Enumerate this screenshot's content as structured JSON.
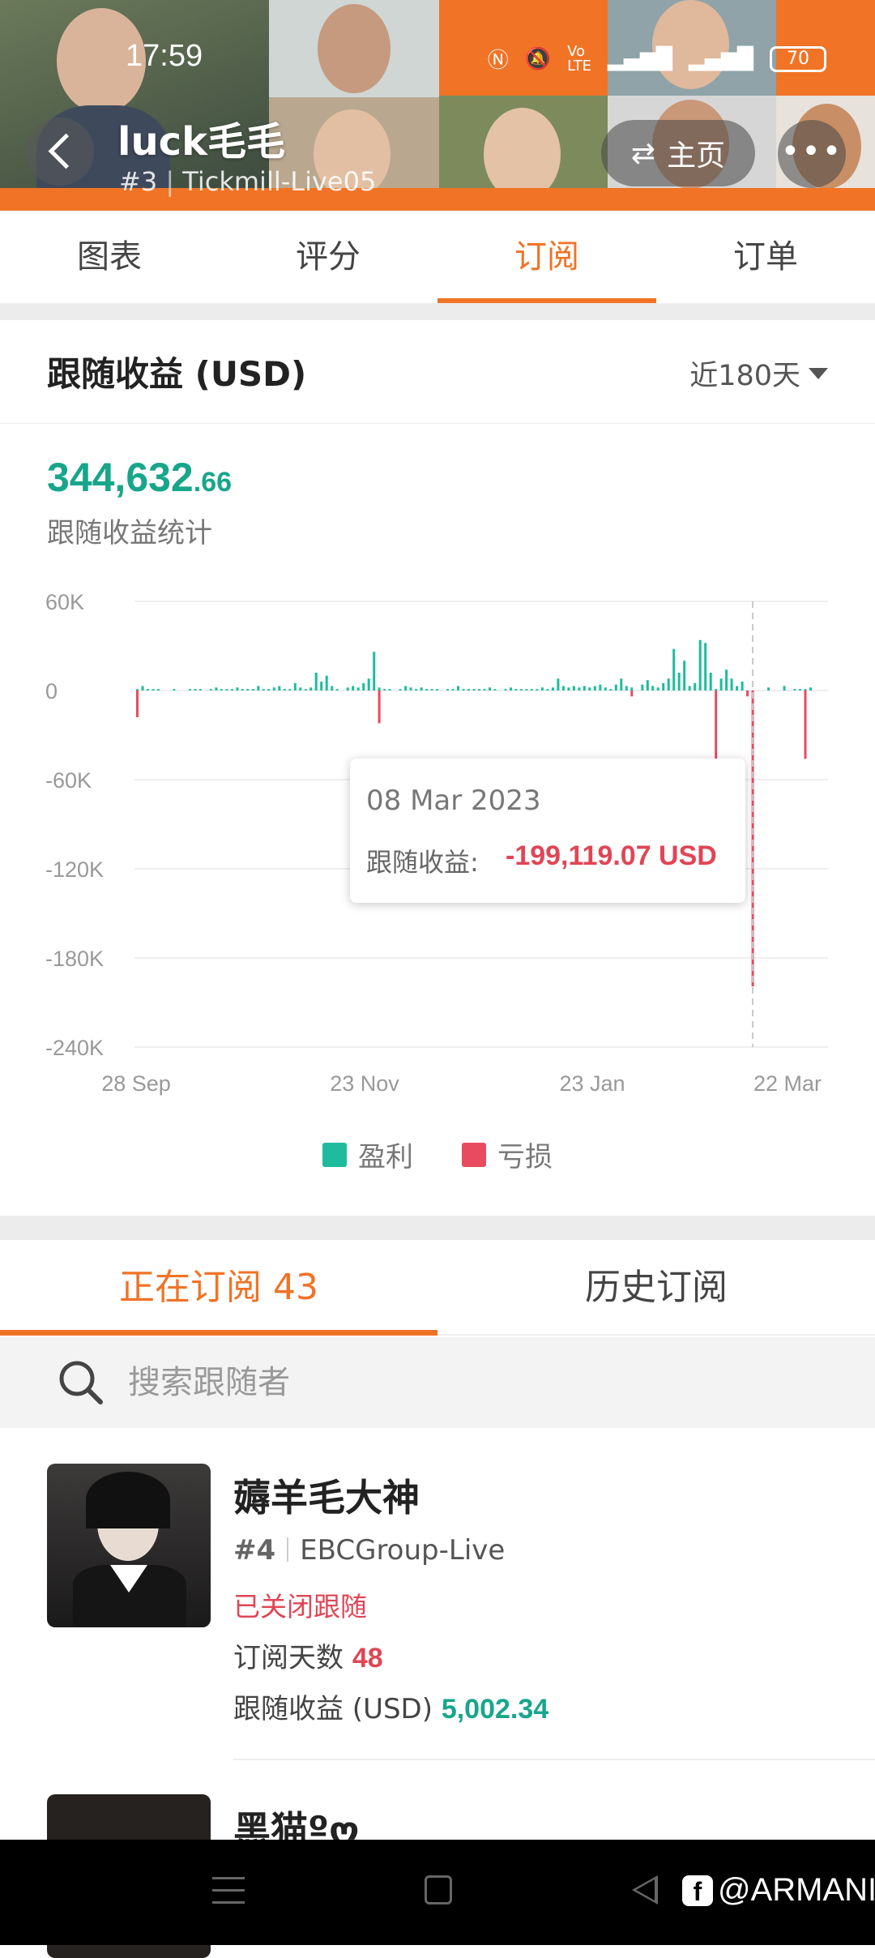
{
  "status_bar": {
    "time": "17:59",
    "battery": "70"
  },
  "header": {
    "name": "luck毛毛",
    "rank": "#3",
    "account": "Tickmill-Live05",
    "home_label": "主页",
    "more_label": "•••"
  },
  "tabs": [
    {
      "label": "图表",
      "active": false
    },
    {
      "label": "评分",
      "active": false
    },
    {
      "label": "订阅",
      "active": true
    },
    {
      "label": "订单",
      "active": false
    }
  ],
  "earnings": {
    "title": "跟随收益 (USD)",
    "period": "近180天",
    "total_int": "344,632",
    "total_dec": ".66",
    "total_label": "跟随收益统计"
  },
  "chart_data": {
    "type": "bar",
    "title": "跟随收益 (USD)",
    "ylim": [
      -240000,
      60000
    ],
    "y_ticks": [
      "60K",
      "0",
      "-60K",
      "-120K",
      "-180K",
      "-240K"
    ],
    "x_ticks": [
      "28 Sep",
      "23 Nov",
      "23 Jan",
      "22 Mar"
    ],
    "legend": [
      {
        "name": "盈利",
        "color": "#1ebc9c"
      },
      {
        "name": "亏损",
        "color": "#e84a5f"
      }
    ],
    "series": [
      {
        "name": "盈利",
        "color": "#1ebc9c",
        "values": [
          1000,
          3000,
          1000,
          1000,
          1000,
          0,
          0,
          1000,
          0,
          0,
          1000,
          1000,
          1000,
          0,
          1000,
          2000,
          1000,
          1000,
          1000,
          2000,
          1000,
          1000,
          1000,
          3000,
          1000,
          1000,
          2000,
          3000,
          1000,
          1000,
          5000,
          2000,
          1000,
          2000,
          12000,
          6000,
          10000,
          3000,
          1000,
          0,
          2000,
          3000,
          2000,
          5000,
          8000,
          26000,
          2000,
          1000,
          1000,
          0,
          1000,
          3000,
          2000,
          1000,
          2000,
          1000,
          1000,
          1000,
          0,
          1000,
          1000,
          3000,
          1000,
          1000,
          1000,
          1000,
          1000,
          2000,
          1000,
          0,
          1000,
          2000,
          1000,
          1000,
          1000,
          1000,
          1000,
          2000,
          1000,
          2000,
          8000,
          3000,
          2000,
          3000,
          2000,
          3000,
          2000,
          3000,
          4000,
          2000,
          1000,
          4000,
          8000,
          3000,
          2000,
          0,
          4000,
          7000,
          3000,
          2000,
          5000,
          8000,
          28000,
          12000,
          20000,
          3000,
          5000,
          34000,
          32000,
          12000,
          1000,
          8000,
          14000,
          8000,
          3000,
          6000,
          0,
          0,
          0,
          0,
          2000,
          0,
          0,
          3000,
          0,
          1000,
          1000,
          1000,
          2000,
          0
        ]
      },
      {
        "name": "亏损",
        "color": "#e84a5f",
        "values": [
          -18000,
          0,
          0,
          0,
          0,
          0,
          0,
          0,
          0,
          0,
          0,
          0,
          0,
          0,
          0,
          0,
          0,
          0,
          0,
          0,
          0,
          0,
          0,
          0,
          0,
          0,
          0,
          0,
          0,
          0,
          0,
          0,
          0,
          0,
          0,
          0,
          0,
          0,
          0,
          0,
          0,
          0,
          0,
          0,
          0,
          0,
          -22000,
          0,
          0,
          0,
          0,
          0,
          0,
          0,
          0,
          0,
          0,
          0,
          0,
          0,
          0,
          0,
          0,
          0,
          0,
          0,
          0,
          0,
          0,
          0,
          0,
          0,
          0,
          0,
          0,
          0,
          0,
          0,
          0,
          0,
          0,
          0,
          0,
          0,
          0,
          0,
          0,
          0,
          0,
          0,
          0,
          0,
          0,
          0,
          -4000,
          0,
          0,
          0,
          0,
          0,
          0,
          0,
          0,
          0,
          0,
          0,
          0,
          0,
          0,
          0,
          -46000,
          0,
          0,
          0,
          0,
          0,
          -4000,
          -199119.07,
          0,
          0,
          0,
          0,
          0,
          0,
          0,
          0,
          0,
          -46000
        ]
      }
    ],
    "highlight": {
      "date": "08 Mar 2023",
      "label": "跟随收益:",
      "value": "-199,119.07 USD"
    }
  },
  "subscriptions": {
    "active_label": "正在订阅 43",
    "history_label": "历史订阅",
    "search_placeholder": "搜索跟随者"
  },
  "followers": [
    {
      "name": "薅羊毛大神",
      "rank": "#4",
      "account": "EBCGroup-Live",
      "status": "已关闭跟随",
      "days_label": "订阅天数",
      "days": "48",
      "profit_label": "跟随收益 (USD)",
      "profit": "5,002.34"
    },
    {
      "name": "黑猫ºღ"
    }
  ],
  "watermark": "@ARMANI",
  "colors": {
    "accent": "#f07326",
    "profit": "#1ebc9c",
    "loss": "#e84a5f"
  }
}
